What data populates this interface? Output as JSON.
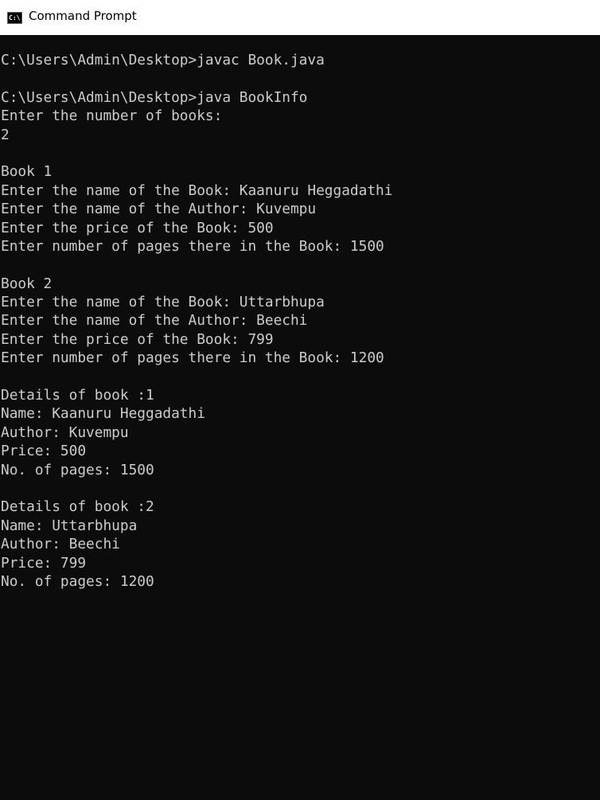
{
  "window": {
    "title": "Command Prompt",
    "icon": "cmd-icon",
    "icon_text": "C:\\"
  },
  "console": {
    "lines": [
      "C:\\Users\\Admin\\Desktop>javac Book.java",
      "",
      "C:\\Users\\Admin\\Desktop>java BookInfo",
      "Enter the number of books:",
      "2",
      "",
      "Book 1",
      "Enter the name of the Book: Kaanuru Heggadathi",
      "Enter the name of the Author: Kuvempu",
      "Enter the price of the Book: 500",
      "Enter number of pages there in the Book: 1500",
      "",
      "Book 2",
      "Enter the name of the Book: Uttarbhupa",
      "Enter the name of the Author: Beechi",
      "Enter the price of the Book: 799",
      "Enter number of pages there in the Book: 1200",
      "",
      "Details of book :1",
      "Name: Kaanuru Heggadathi",
      "Author: Kuvempu",
      "Price: 500",
      "No. of pages: 1500",
      "",
      "Details of book :2",
      "Name: Uttarbhupa",
      "Author: Beechi",
      "Price: 799",
      "No. of pages: 1200"
    ]
  }
}
